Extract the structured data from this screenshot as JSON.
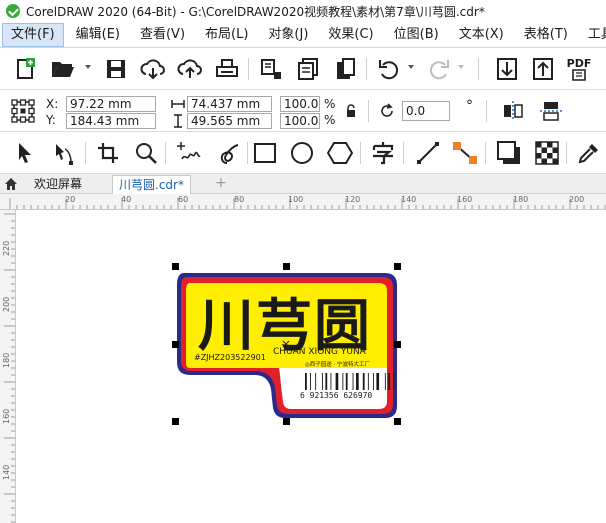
{
  "window": {
    "title": "CorelDRAW 2020 (64-Bit) - G:\\CorelDRAW2020视频教程\\素材\\第7章\\川芎圆.cdr*"
  },
  "menu": {
    "items": [
      {
        "label": "文件(F)",
        "name": "menu-file",
        "active": true
      },
      {
        "label": "编辑(E)",
        "name": "menu-edit"
      },
      {
        "label": "查看(V)",
        "name": "menu-view"
      },
      {
        "label": "布局(L)",
        "name": "menu-layout"
      },
      {
        "label": "对象(J)",
        "name": "menu-object"
      },
      {
        "label": "效果(C)",
        "name": "menu-effects"
      },
      {
        "label": "位图(B)",
        "name": "menu-bitmaps"
      },
      {
        "label": "文本(X)",
        "name": "menu-text"
      },
      {
        "label": "表格(T)",
        "name": "menu-table"
      },
      {
        "label": "工具",
        "name": "menu-tools"
      }
    ]
  },
  "standard_toolbar": {
    "pdf_label": "PDF"
  },
  "property_bar": {
    "x_label": "X:",
    "y_label": "Y:",
    "x_value": "97.22 mm",
    "y_value": "184.43 mm",
    "width_value": "74.437 mm",
    "height_value": "49.565 mm",
    "scale_w": "100.0",
    "scale_h": "100.0",
    "percent": "%",
    "rotation_value": "0.0",
    "degree": "°"
  },
  "tabs": {
    "welcome": "欢迎屏幕",
    "document": "川芎圆.cdr*",
    "add": "+"
  },
  "ruler": {
    "h_labels": [
      "20",
      "40",
      "60",
      "80",
      "100",
      "120",
      "140",
      "160",
      "180",
      "200"
    ],
    "v_labels": [
      "220",
      "200",
      "180",
      "160",
      "140"
    ]
  },
  "label_art": {
    "brand": "川芎圆",
    "code": "#ZJHZ203522901",
    "pinyin": "CHUAN XIONG YUNA",
    "tagline": "◎西子园送 · 宁波特大工厂",
    "barcode_number": "6 921356 626970",
    "colors": {
      "outer_border": "#2a2a8c",
      "red_band": "#e0202a",
      "yellow_fill": "#ffee00",
      "ink": "#1a1a1a"
    }
  }
}
